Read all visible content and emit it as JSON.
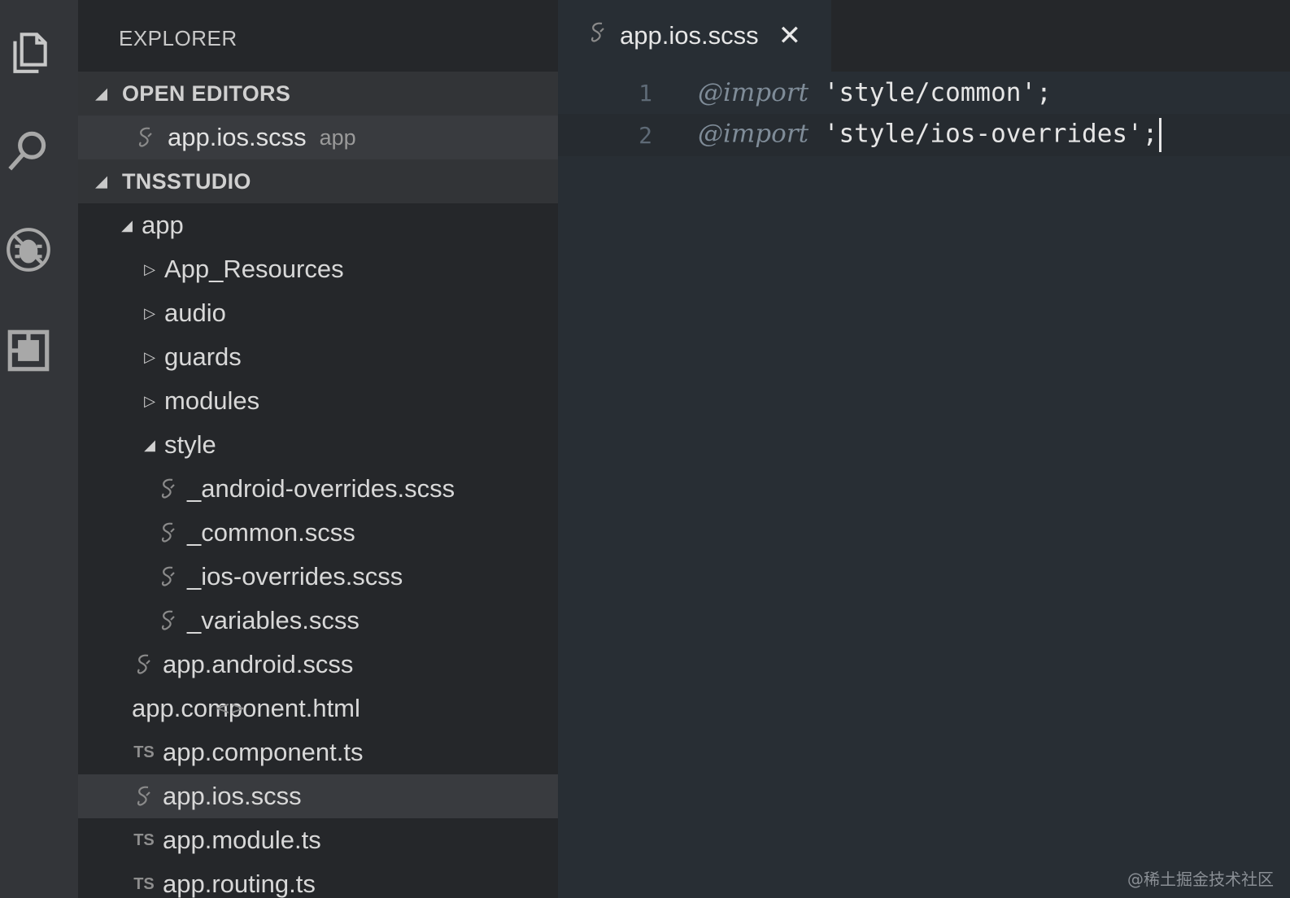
{
  "activity_bar": {
    "icons": [
      "files-icon",
      "search-icon",
      "debug-icon",
      "extensions-icon"
    ]
  },
  "sidebar": {
    "title": "EXPLORER",
    "open_editors": {
      "header": "OPEN EDITORS",
      "items": [
        {
          "label": "app.ios.scss",
          "description": "app",
          "icon": "sass-icon"
        }
      ]
    },
    "project": {
      "header": "TNSSTUDIO",
      "tree": [
        {
          "label": "app",
          "type": "folder",
          "expanded": true
        },
        {
          "label": "App_Resources",
          "type": "folder",
          "expanded": false
        },
        {
          "label": "audio",
          "type": "folder",
          "expanded": false
        },
        {
          "label": "guards",
          "type": "folder",
          "expanded": false
        },
        {
          "label": "modules",
          "type": "folder",
          "expanded": false
        },
        {
          "label": "style",
          "type": "folder",
          "expanded": true
        },
        {
          "label": "_android-overrides.scss",
          "type": "file",
          "icon": "sass-icon"
        },
        {
          "label": "_common.scss",
          "type": "file",
          "icon": "sass-icon"
        },
        {
          "label": "_ios-overrides.scss",
          "type": "file",
          "icon": "sass-icon"
        },
        {
          "label": "_variables.scss",
          "type": "file",
          "icon": "sass-icon"
        },
        {
          "label": "app.android.scss",
          "type": "file",
          "icon": "sass-icon"
        },
        {
          "label": "app.component.html",
          "type": "file",
          "icon": "html-icon",
          "icon_text": "<>"
        },
        {
          "label": "app.component.ts",
          "type": "file",
          "icon": "typescript-icon",
          "icon_text": "TS"
        },
        {
          "label": "app.ios.scss",
          "type": "file",
          "icon": "sass-icon",
          "selected": true
        },
        {
          "label": "app.module.ts",
          "type": "file",
          "icon": "typescript-icon",
          "icon_text": "TS"
        },
        {
          "label": "app.routing.ts",
          "type": "file",
          "icon": "typescript-icon",
          "icon_text": "TS"
        }
      ]
    }
  },
  "editor": {
    "tab": {
      "label": "app.ios.scss",
      "close_symbol": "✕"
    },
    "lines": [
      {
        "number": "1",
        "keyword": "@import",
        "string": "'style/common';"
      },
      {
        "number": "2",
        "keyword": "@import",
        "string": "'style/ios-overrides';"
      }
    ]
  },
  "watermark": "@稀土掘金技术社区",
  "colors": {
    "activity_bar_bg": "#333539",
    "sidebar_bg": "#25272a",
    "section_header_bg": "#323437",
    "selected_row_bg": "#393b3f",
    "editor_bg": "#282e34"
  }
}
